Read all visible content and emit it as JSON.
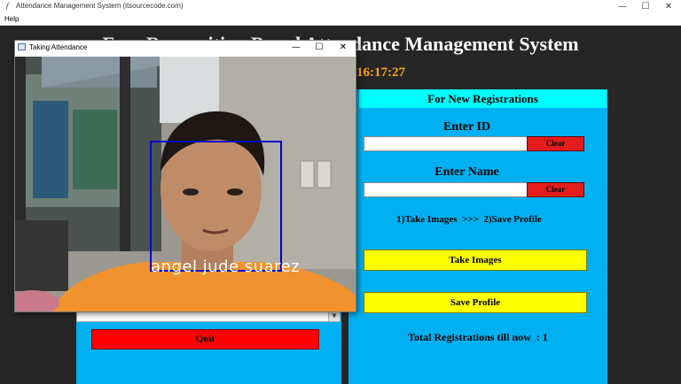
{
  "window": {
    "title": "Attendance Management System (itsourcecode.com)",
    "minimize": "—",
    "maximize": "☐",
    "close": "✕"
  },
  "menu": {
    "help": "Help"
  },
  "app": {
    "main_title": "Face Recognition Based Attendance Management System",
    "clock": "16:17:27"
  },
  "left_panel": {
    "quit_label": "Quit"
  },
  "right_panel": {
    "header": "For New Registrations",
    "id_label": "Enter ID",
    "id_value": "",
    "name_label": "Enter Name",
    "name_value": "",
    "clear_label": "Clear",
    "instructions": "1)Take Images  >>>  2)Save Profile",
    "take_images_label": "Take Images",
    "save_profile_label": "Save Profile",
    "total_label": "Total Registrations till now  : 1"
  },
  "camera_window": {
    "title": "Taking Attendance",
    "recognized_name": "angel jude suarez",
    "box_color": "#0000cc"
  },
  "colors": {
    "background": "#262626",
    "panel": "#00b0f0",
    "header": "#00ffff",
    "clock": "#ffa41b",
    "button_red": "#ff0000",
    "button_yellow": "#ffff00"
  }
}
